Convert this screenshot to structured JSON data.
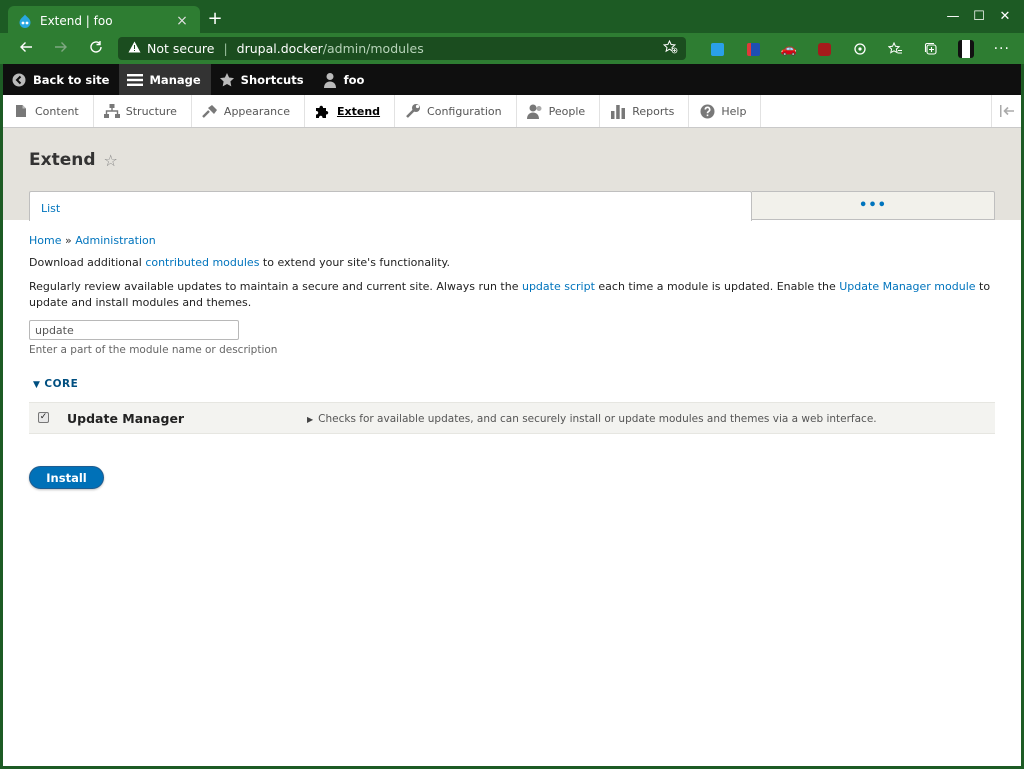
{
  "browser": {
    "tab_title": "Extend | foo",
    "tab_close": "×",
    "new_tab": "+",
    "security_label": "Not secure",
    "url_host": "drupal.docker",
    "url_path": "/admin/modules",
    "window_controls": {
      "minimize": "—",
      "maximize": "☐",
      "close": "✕"
    }
  },
  "toolbar": {
    "back_to_site": "Back to site",
    "manage": "Manage",
    "shortcuts": "Shortcuts",
    "user": "foo"
  },
  "tray": {
    "items": [
      {
        "label": "Content"
      },
      {
        "label": "Structure"
      },
      {
        "label": "Appearance"
      },
      {
        "label": "Extend"
      },
      {
        "label": "Configuration"
      },
      {
        "label": "People"
      },
      {
        "label": "Reports"
      },
      {
        "label": "Help"
      }
    ]
  },
  "page": {
    "title": "Extend",
    "tabs": {
      "list": "List",
      "more": "•••"
    },
    "breadcrumb": {
      "home": "Home",
      "sep": "»",
      "admin": "Administration"
    },
    "intro": {
      "pre": "Download additional ",
      "link": "contributed modules",
      "post": " to extend your site's functionality."
    },
    "notice": {
      "pre": "Regularly review available updates to maintain a secure and current site. Always run the ",
      "link1": "update script",
      "mid": " each time a module is updated. Enable the ",
      "link2": "Update Manager module",
      "post": " to update and install modules and themes."
    },
    "filter": {
      "value": "update",
      "description": "Enter a part of the module name or description"
    },
    "group": "CORE",
    "module": {
      "name": "Update Manager",
      "description": "Checks for available updates, and can securely install or update modules and themes via a web interface."
    },
    "install_button": "Install"
  }
}
